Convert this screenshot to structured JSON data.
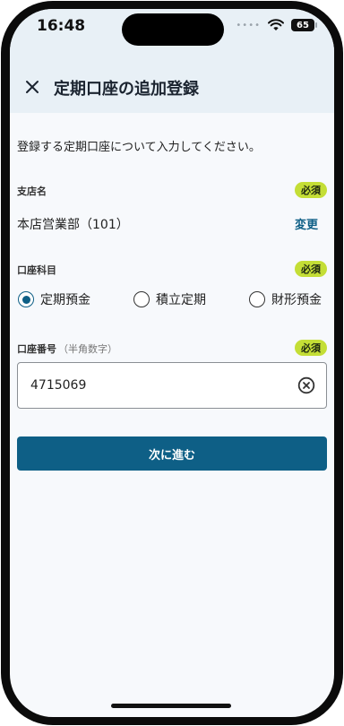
{
  "status_bar": {
    "time": "16:48",
    "battery": "65"
  },
  "header": {
    "title": "定期口座の追加登録"
  },
  "intro": "登録する定期口座について入力してください。",
  "branch_field": {
    "label": "支店名",
    "required": "必須",
    "value": "本店営業部（101）",
    "change_label": "変更"
  },
  "account_type_field": {
    "label": "口座科目",
    "required": "必須",
    "options": [
      {
        "label": "定期預金",
        "selected": true
      },
      {
        "label": "積立定期",
        "selected": false
      },
      {
        "label": "財形預金",
        "selected": false
      }
    ]
  },
  "account_number_field": {
    "label": "口座番号",
    "hint": "（半角数字）",
    "required": "必須",
    "value": "4715069"
  },
  "next_button": {
    "label": "次に進む"
  },
  "colors": {
    "primary": "#0e5f86",
    "required_badge": "#c4de36",
    "header_bg": "#e8f0f6"
  },
  "icons": {
    "close": "close-icon",
    "clear": "clear-circle-icon",
    "wifi": "wifi-icon",
    "battery": "battery-icon"
  }
}
